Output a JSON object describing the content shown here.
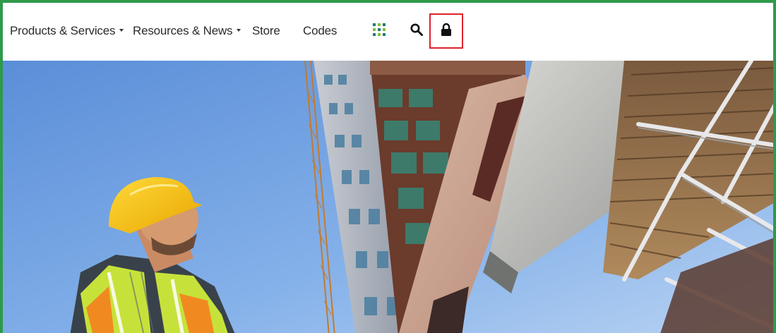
{
  "nav": {
    "items": [
      {
        "label": "Products & Services",
        "has_dropdown": true
      },
      {
        "label": "Resources & News",
        "has_dropdown": true
      },
      {
        "label": "Store",
        "has_dropdown": false
      },
      {
        "label": "Codes",
        "has_dropdown": false
      }
    ],
    "icons": [
      "grid-icon",
      "search-icon",
      "lock-icon"
    ]
  },
  "colors": {
    "frame_border": "#2e9a4b",
    "highlight": "#e0222b",
    "grid_icon_teal": "#1f7a74",
    "grid_icon_green": "#7fbf3f"
  }
}
